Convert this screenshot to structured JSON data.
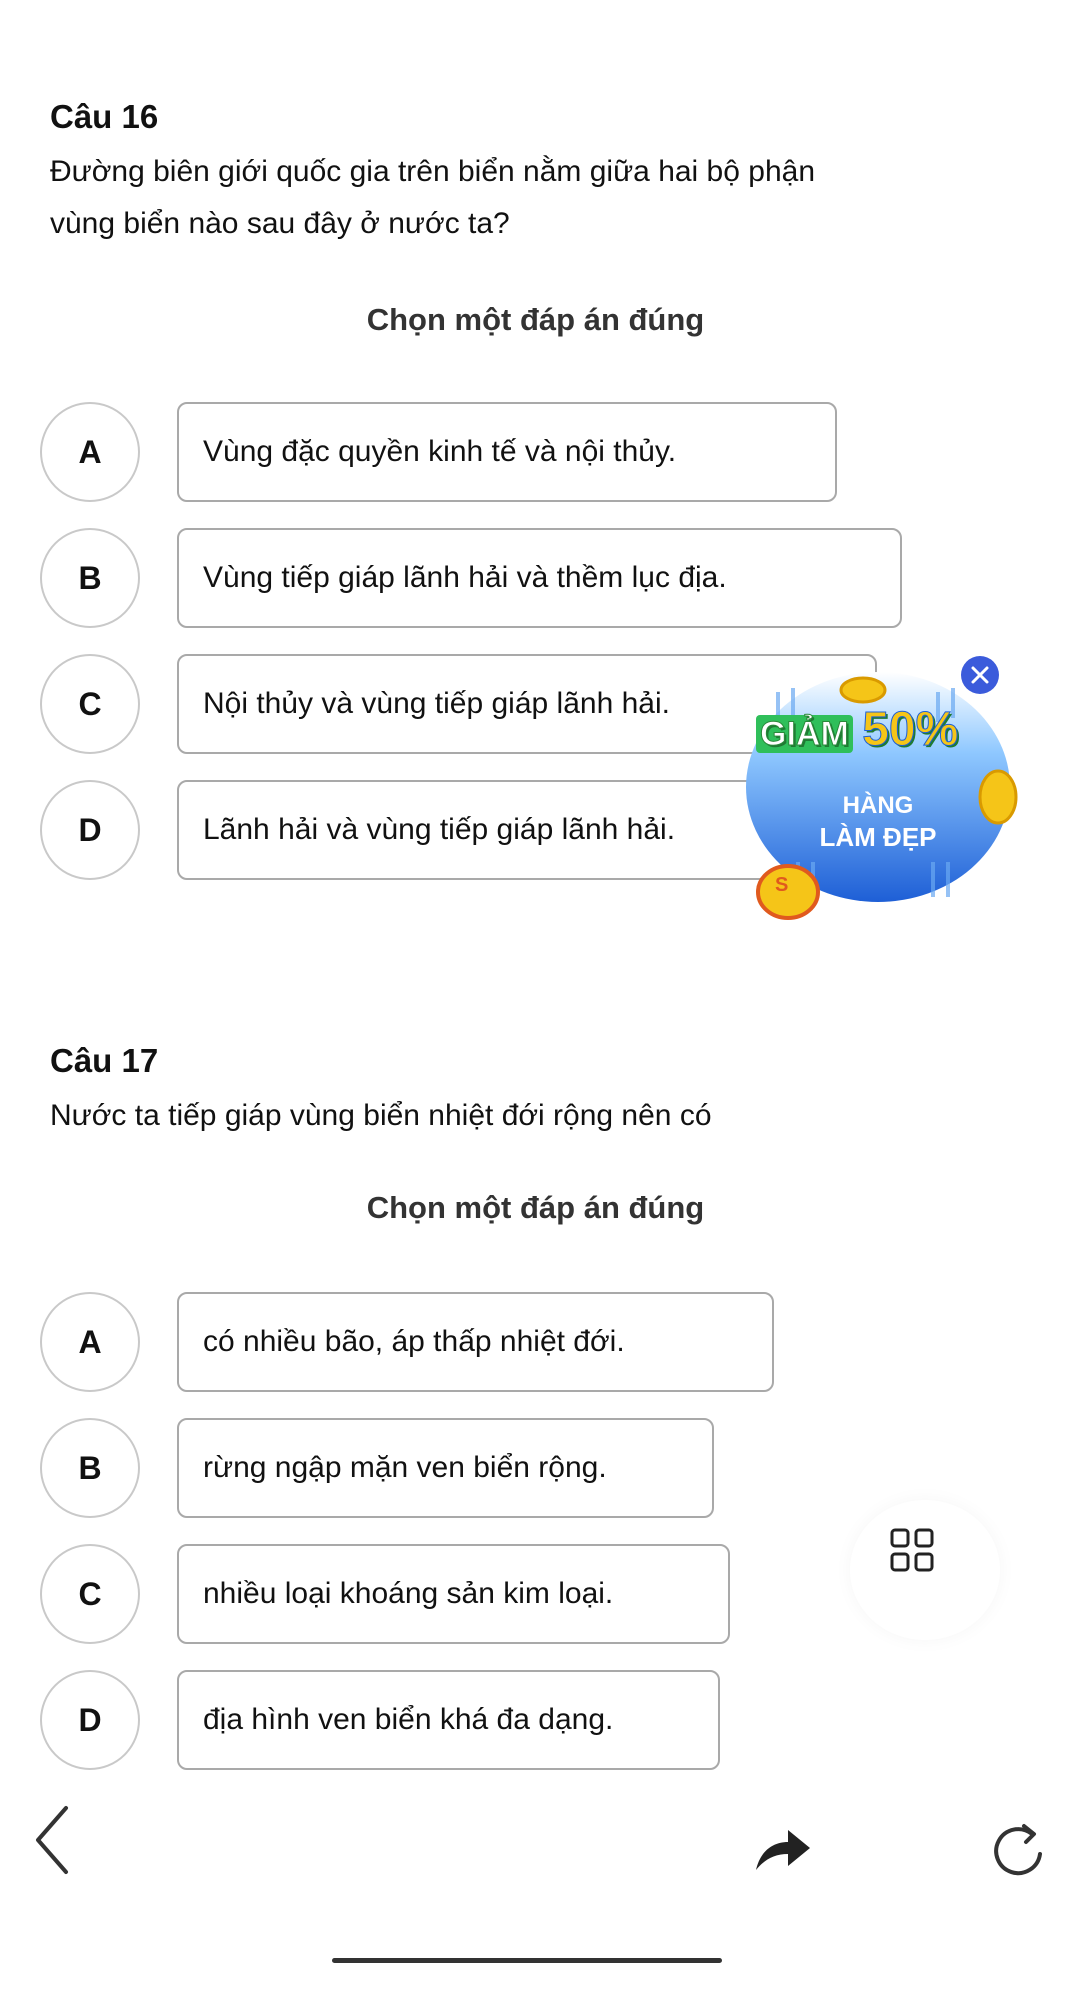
{
  "q16": {
    "label": "Câu 16",
    "line1": "Đường biên giới quốc gia trên biển nằm giữa hai bộ phận",
    "line2": "vùng biển nào sau đây ở nước ta?",
    "prompt": "Chọn một đáp án đúng",
    "options": [
      {
        "letter": "A",
        "text": "Vùng đặc quyền kinh tế và nội thủy."
      },
      {
        "letter": "B",
        "text": "Vùng tiếp giáp lãnh hải và thềm lục địa."
      },
      {
        "letter": "C",
        "text": "Nội thủy và vùng tiếp giáp lãnh hải."
      },
      {
        "letter": "D",
        "text": "Lãnh hải và vùng tiếp giáp lãnh hải."
      }
    ]
  },
  "q17": {
    "label": "Câu 17",
    "line1": "Nước ta tiếp giáp vùng biển nhiệt đới rộng nên có",
    "prompt": "Chọn một đáp án đúng",
    "options": [
      {
        "letter": "A",
        "text": "có nhiều bão, áp thấp nhiệt đới."
      },
      {
        "letter": "B",
        "text": "rừng ngập mặn ven biển rộng."
      },
      {
        "letter": "C",
        "text": "nhiều loại khoáng sản kim loại."
      },
      {
        "letter": "D",
        "text": "địa hình ven biển khá đa dạng."
      }
    ]
  },
  "ad": {
    "discount_prefix": "GIẢM",
    "discount_value": "50%",
    "line1": "HÀNG",
    "line2": "LÀM ĐẸP",
    "coin_letter": "S"
  },
  "icons": {
    "ad_close": "close-icon",
    "grid": "grid-icon",
    "back": "chevron-left-icon",
    "share": "share-arrow-icon",
    "refresh": "refresh-icon"
  },
  "colors": {
    "ad_blue": "#1e5fd6",
    "ad_gold": "#f5c518",
    "ad_green": "#2fbf5a",
    "option_border": "#a9a9a9",
    "circle_border": "#c9c9c9"
  }
}
